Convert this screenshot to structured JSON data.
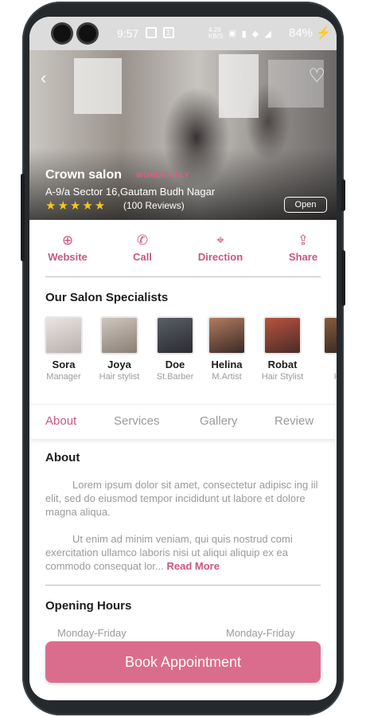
{
  "status_bar": {
    "time": "9:57",
    "network_speed": "4.29\nKB/S",
    "battery": "84%"
  },
  "hero": {
    "salon_name": "Crown salon",
    "tag": "WOMEN ONLY",
    "address": "A-9/a Sector 16,Gautam Budh Nagar",
    "rating_stars": "★★★★★",
    "reviews": "(100 Reviews)",
    "status": "Open"
  },
  "actions": [
    {
      "label": "Website",
      "icon": "globe-icon"
    },
    {
      "label": "Call",
      "icon": "phone-icon"
    },
    {
      "label": "Direction",
      "icon": "map-pin-icon"
    },
    {
      "label": "Share",
      "icon": "share-icon"
    }
  ],
  "specialists": {
    "title": "Our Salon Specialists",
    "items": [
      {
        "name": "Sora",
        "role": "Manager"
      },
      {
        "name": "Joya",
        "role": "Hair stylist"
      },
      {
        "name": "Doe",
        "role": "St.Barber"
      },
      {
        "name": "Helina",
        "role": "M.Artist"
      },
      {
        "name": "Robat",
        "role": "Hair Stylist"
      },
      {
        "name": "R",
        "role": "Hair"
      }
    ]
  },
  "tabs": [
    {
      "label": "About",
      "active": true
    },
    {
      "label": "Services",
      "active": false
    },
    {
      "label": "Gallery",
      "active": false
    },
    {
      "label": "Review",
      "active": false
    }
  ],
  "about": {
    "title": "About",
    "paragraph1": "Lorem ipsum dolor sit amet, consectetur adipisc ing iil elit, sed do eiusmod tempor incididunt ut labore et dolore magna aliqua.",
    "paragraph2": "Ut enim ad minim veniam, qui quis nostrud comi exercitation ullamco laboris nisi ut aliqui aliquip ex ea commodo consequat lor...",
    "read_more": "Read More"
  },
  "opening_hours": {
    "title": "Opening Hours",
    "col1": "Monday-Friday",
    "col2": "Monday-Friday"
  },
  "book_button": "Book Appointment",
  "colors": {
    "accent": "#c8587b",
    "button": "#da6d8d",
    "star": "#f7c61c"
  }
}
